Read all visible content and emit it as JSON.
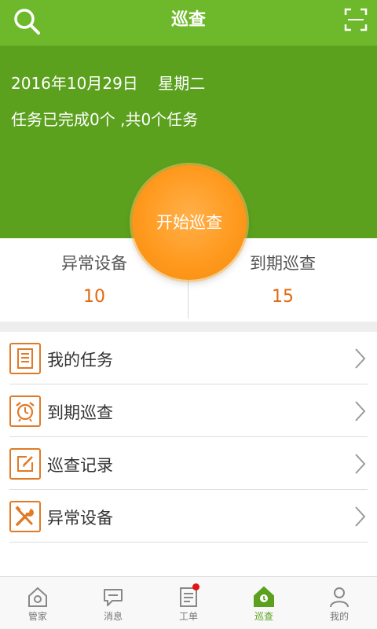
{
  "header": {
    "title": "巡查",
    "search_icon": "search-icon",
    "scan_icon": "scan-icon"
  },
  "hero": {
    "date": "2016年10月29日    星期二",
    "task_summary": "任务已完成0个 ,共0个任务",
    "start_button": "开始巡查"
  },
  "stats": [
    {
      "label": "异常设备",
      "value": "10"
    },
    {
      "label": "到期巡查",
      "value": "15"
    }
  ],
  "menu": [
    {
      "label": "我的任务",
      "icon": "document-list-icon"
    },
    {
      "label": "到期巡查",
      "icon": "alarm-clock-icon"
    },
    {
      "label": "巡查记录",
      "icon": "edit-note-icon"
    },
    {
      "label": "异常设备",
      "icon": "tools-icon"
    }
  ],
  "tabs": [
    {
      "label": "管家",
      "icon": "house-icon"
    },
    {
      "label": "消息",
      "icon": "chat-icon"
    },
    {
      "label": "工单",
      "icon": "clipboard-icon"
    },
    {
      "label": "巡查",
      "icon": "inspection-house-icon"
    },
    {
      "label": "我的",
      "icon": "user-icon"
    }
  ],
  "colors": {
    "green": "#6eb92b",
    "hero_green": "#5ba11e",
    "orange": "#f58a0b",
    "accent_text": "#e26a10",
    "badge_red": "#e01414"
  }
}
